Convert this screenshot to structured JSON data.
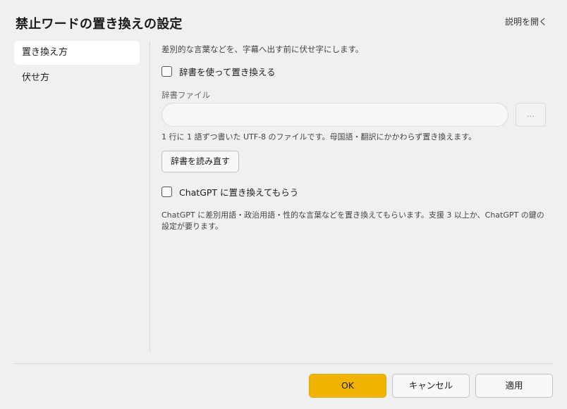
{
  "dialog": {
    "title": "禁止ワードの置き換えの設定",
    "help_link": "説明を開く"
  },
  "sidebar": {
    "items": [
      {
        "label": "置き換え方",
        "active": true
      },
      {
        "label": "伏せ方",
        "active": false
      }
    ]
  },
  "main": {
    "description": "差別的な言葉などを、字幕へ出す前に伏せ字にします。",
    "dictionary_checkbox": {
      "label": "辞書を使って置き換える",
      "checked": false
    },
    "dictionary_file": {
      "label": "辞書ファイル",
      "value": "",
      "placeholder": "",
      "browse_label": "..."
    },
    "dictionary_note": "1 行に 1 語ずつ書いた UTF-8 のファイルです。母国語・翻訳にかかわらず置き換えます。",
    "reload_button": "辞書を読み直す",
    "chatgpt_checkbox": {
      "label": "ChatGPT に置き換えてもらう",
      "checked": false
    },
    "chatgpt_note": "ChatGPT に差別用語・政治用語・性的な言葉などを置き換えてもらいます。支援 3 以上か、ChatGPT の鍵の設定が要ります。"
  },
  "footer": {
    "ok": "OK",
    "cancel": "キャンセル",
    "apply": "適用"
  },
  "colors": {
    "accent": "#f0b400",
    "background": "#f0f0f0"
  }
}
